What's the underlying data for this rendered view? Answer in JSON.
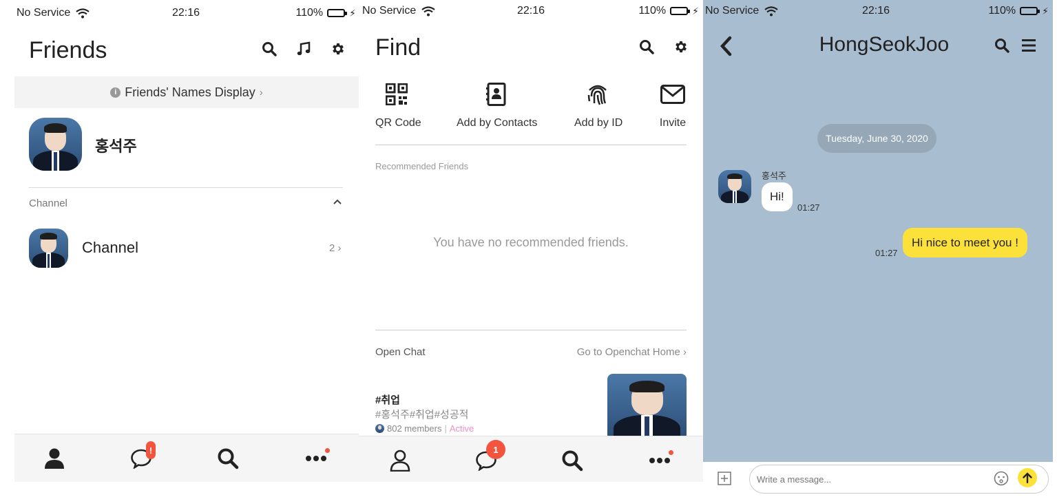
{
  "status": {
    "carrier": "No Service",
    "time": "22:16",
    "battery": "110%"
  },
  "friends": {
    "title": "Friends",
    "names_display": "Friends' Names Display",
    "my_name": "홍석주",
    "section_channel": "Channel",
    "channel_name": "Channel",
    "channel_count": "2",
    "tab_chat_badge": "!"
  },
  "find": {
    "title": "Find",
    "items": [
      {
        "label": "QR Code",
        "icon": "qr-code-icon"
      },
      {
        "label": "Add by Contacts",
        "icon": "contacts-icon"
      },
      {
        "label": "Add by ID",
        "icon": "fingerprint-icon"
      },
      {
        "label": "Invite",
        "icon": "envelope-icon"
      }
    ],
    "recommended_label": "Recommended Friends",
    "empty_text": "You have no recommended friends.",
    "openchat_label": "Open Chat",
    "openchat_link": "Go to Openchat Home",
    "openchat_title": "#취업",
    "openchat_tags": "#홍석주#취업#성공적",
    "openchat_members": "802 members",
    "openchat_sep": "|",
    "openchat_status": "Active",
    "tab_chat_badge": "1"
  },
  "chat": {
    "title": "HongSeokJoo",
    "date": "Tuesday, June 30, 2020",
    "sender": "홍석주",
    "msg_in": "Hi!",
    "time_in": "01:27",
    "msg_out": "Hi nice to meet you !",
    "time_out": "01:27",
    "input_placeholder": "Write a message...",
    "bg_color": "#a9bdd0",
    "out_bubble_color": "#fde13b"
  }
}
